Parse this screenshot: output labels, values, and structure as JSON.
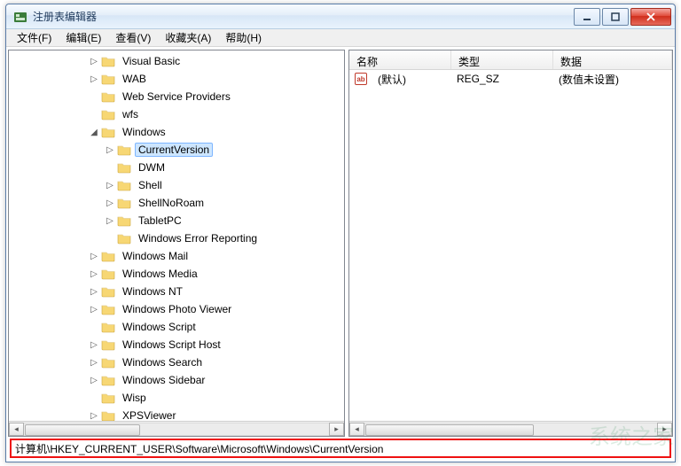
{
  "window": {
    "title": "注册表编辑器"
  },
  "menu": [
    {
      "label": "文件(F)"
    },
    {
      "label": "编辑(E)"
    },
    {
      "label": "查看(V)"
    },
    {
      "label": "收藏夹(A)"
    },
    {
      "label": "帮助(H)"
    }
  ],
  "tree": [
    {
      "depth": 5,
      "expander": "▷",
      "label": "Visual Basic"
    },
    {
      "depth": 5,
      "expander": "▷",
      "label": "WAB"
    },
    {
      "depth": 5,
      "expander": "",
      "label": "Web Service Providers"
    },
    {
      "depth": 5,
      "expander": "",
      "label": "wfs"
    },
    {
      "depth": 5,
      "expander": "◢",
      "label": "Windows"
    },
    {
      "depth": 6,
      "expander": "▷",
      "label": "CurrentVersion",
      "selected": true
    },
    {
      "depth": 6,
      "expander": "",
      "label": "DWM"
    },
    {
      "depth": 6,
      "expander": "▷",
      "label": "Shell"
    },
    {
      "depth": 6,
      "expander": "▷",
      "label": "ShellNoRoam"
    },
    {
      "depth": 6,
      "expander": "▷",
      "label": "TabletPC"
    },
    {
      "depth": 6,
      "expander": "",
      "label": "Windows Error Reporting"
    },
    {
      "depth": 5,
      "expander": "▷",
      "label": "Windows Mail"
    },
    {
      "depth": 5,
      "expander": "▷",
      "label": "Windows Media"
    },
    {
      "depth": 5,
      "expander": "▷",
      "label": "Windows NT"
    },
    {
      "depth": 5,
      "expander": "▷",
      "label": "Windows Photo Viewer"
    },
    {
      "depth": 5,
      "expander": "",
      "label": "Windows Script"
    },
    {
      "depth": 5,
      "expander": "▷",
      "label": "Windows Script Host"
    },
    {
      "depth": 5,
      "expander": "▷",
      "label": "Windows Search"
    },
    {
      "depth": 5,
      "expander": "▷",
      "label": "Windows Sidebar"
    },
    {
      "depth": 5,
      "expander": "",
      "label": "Wisp"
    },
    {
      "depth": 5,
      "expander": "▷",
      "label": "XPSViewer"
    }
  ],
  "columns": {
    "name": "名称",
    "type": "类型",
    "data": "数据",
    "widths": [
      115,
      115,
      140
    ]
  },
  "values": [
    {
      "name": "(默认)",
      "type": "REG_SZ",
      "data": "(数值未设置)"
    }
  ],
  "status": "计算机\\HKEY_CURRENT_USER\\Software\\Microsoft\\Windows\\CurrentVersion",
  "watermark": "系统之家"
}
